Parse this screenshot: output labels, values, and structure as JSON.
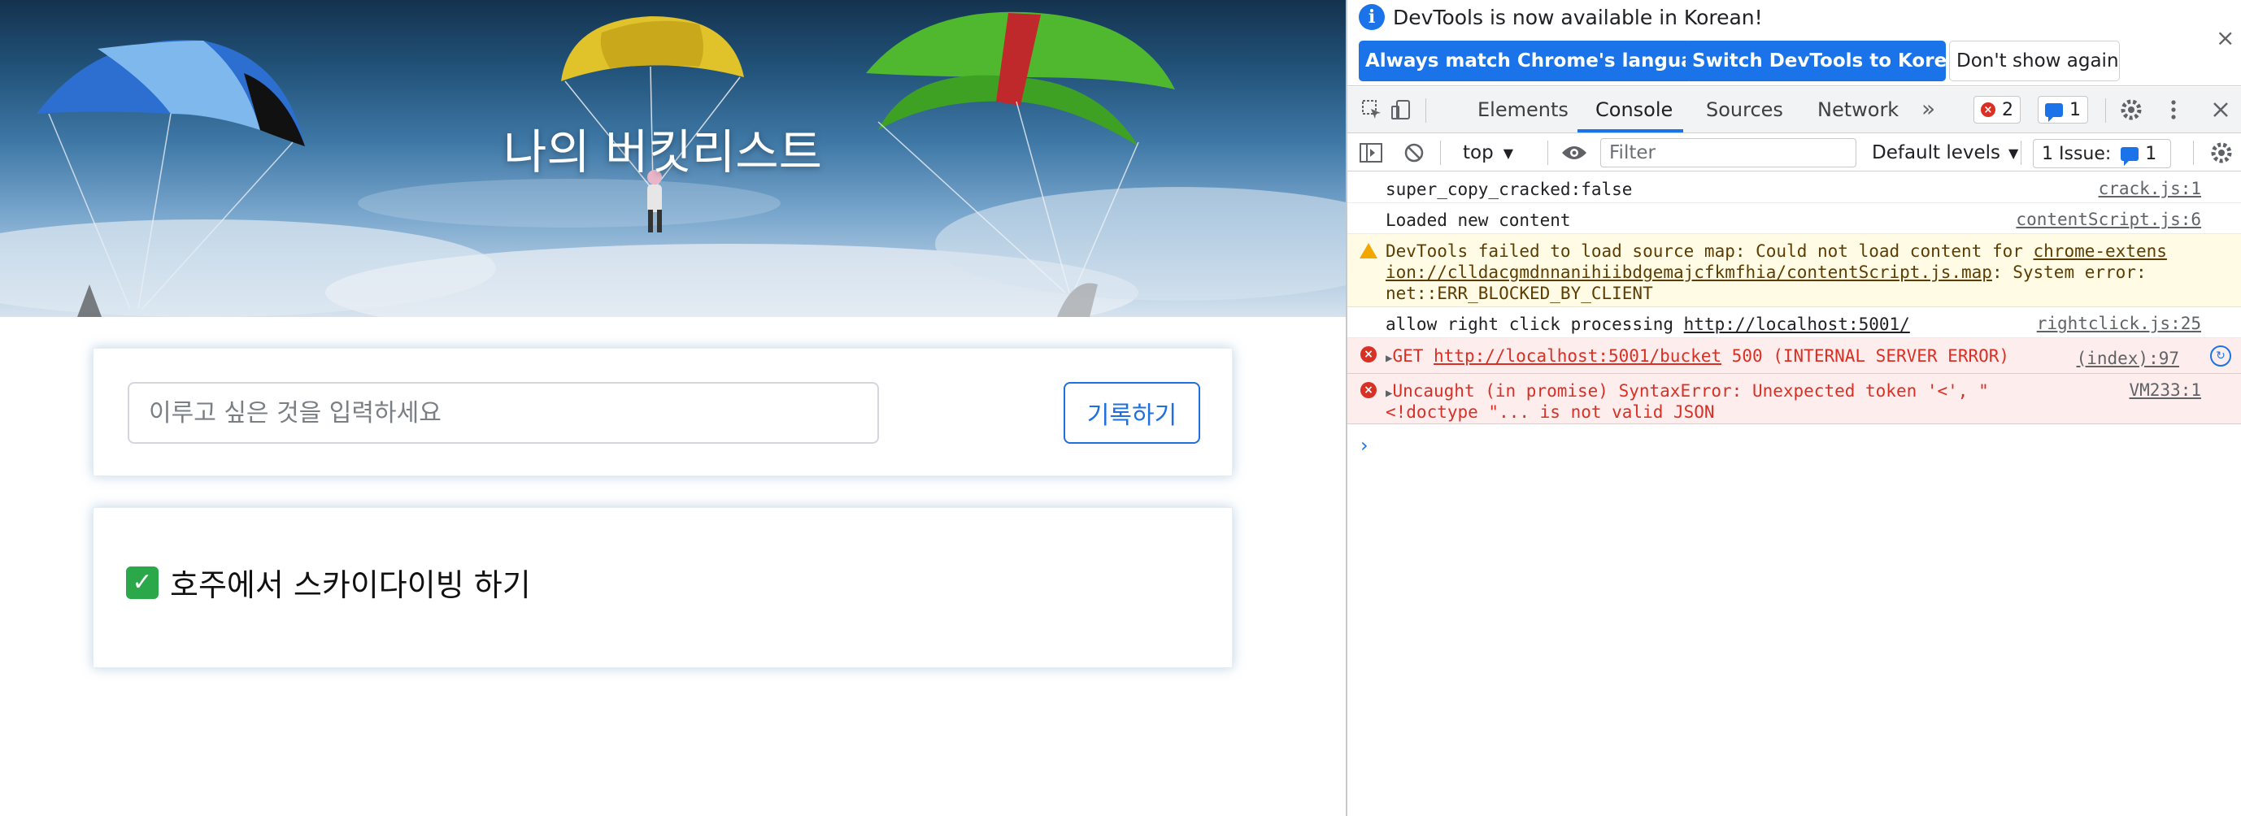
{
  "page": {
    "banner_title": "나의 버킷리스트",
    "input_placeholder": "이루고 싶은 것을 입력하세요",
    "save_button": "기록하기",
    "goals": [
      {
        "icon": "✓",
        "text": "호주에서 스카이다이빙 하기"
      }
    ]
  },
  "devtools": {
    "infobar": {
      "message": "DevTools is now available in Korean!",
      "btn_match": "Always match Chrome's language",
      "btn_switch": "Switch DevTools to Korean",
      "btn_dismiss": "Don't show again",
      "close": "×"
    },
    "tabs": [
      "Elements",
      "Console",
      "Sources",
      "Network"
    ],
    "more_tabs": "»",
    "error_count": "2",
    "message_count": "1",
    "toolbar": {
      "context": "top",
      "filter_placeholder": "Filter",
      "levels": "Default levels",
      "issues_label": "1 Issue:",
      "issues_count": "1"
    },
    "logs": [
      {
        "type": "info",
        "text": "super_copy_cracked:false",
        "source": "crack.js:1"
      },
      {
        "type": "info",
        "text": "Loaded new content",
        "source": "contentScript.js:6"
      },
      {
        "type": "warning",
        "line1_prefix": "DevTools failed to load source map: Could not load content for ",
        "line1_link": "chrome-extens",
        "line2_link": "ion://clldacgmdnnanihiibdgemajcfkmfhia/contentScript.js.map",
        "line2_suffix": ": System error:",
        "line3": "net::ERR_BLOCKED_BY_CLIENT"
      },
      {
        "type": "info",
        "prefix": "allow right click processing ",
        "link": "http://localhost:5001/",
        "source": "rightclick.js:25"
      },
      {
        "type": "error",
        "prefix": "GET ",
        "link": "http://localhost:5001/bucket",
        "suffix": " 500 (INTERNAL SERVER ERROR)",
        "source": "(index):97"
      },
      {
        "type": "error",
        "line1": "Uncaught (in promise) SyntaxError: Unexpected token '<', \"",
        "line2": "<!doctype \"... is not valid JSON",
        "source": "VM233:1"
      }
    ],
    "prompt": "›"
  },
  "colors": {
    "accent": "#1a73e8",
    "error": "#d93025",
    "warning": "#f2a600",
    "check": "#2aa84a"
  }
}
